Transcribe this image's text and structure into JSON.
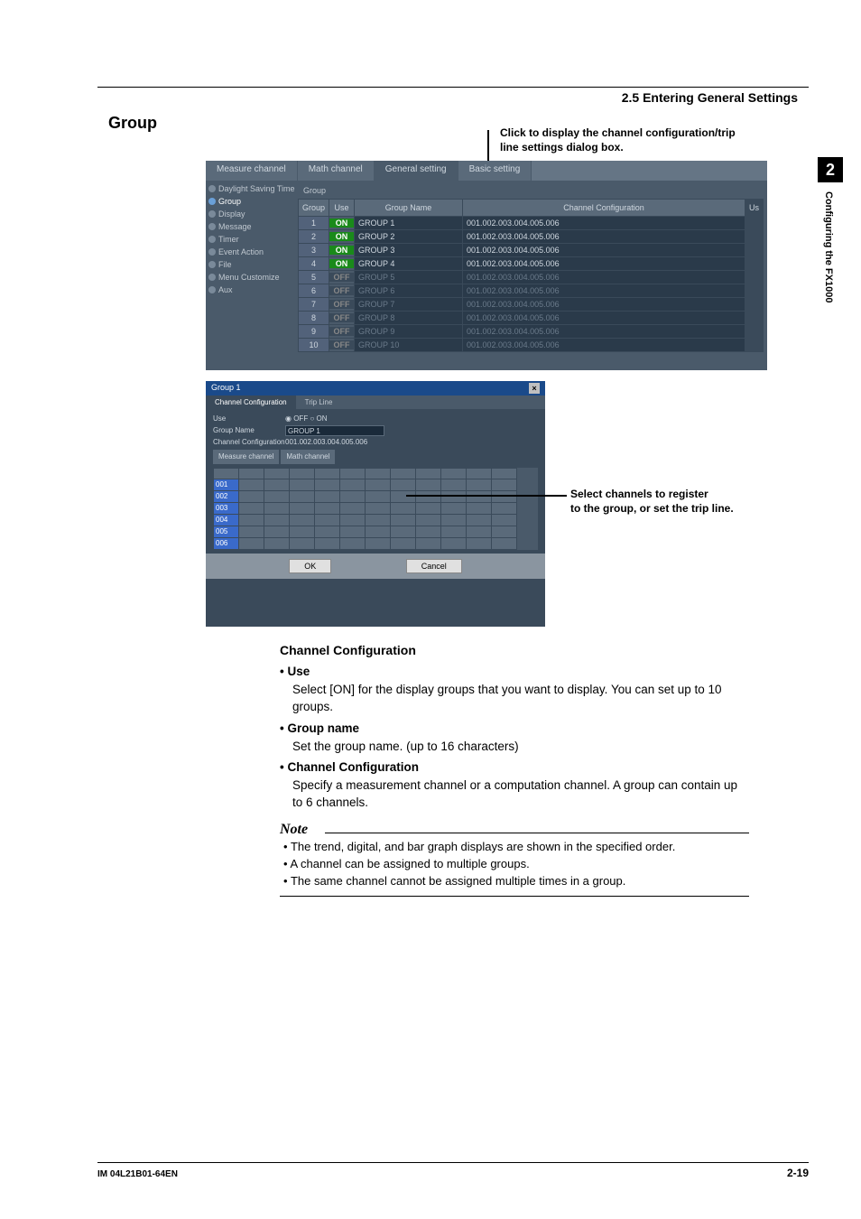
{
  "page": {
    "section_header": "2.5  Entering General Settings",
    "title": "Group",
    "footer_left": "IM 04L21B01-64EN",
    "footer_right": "2-19",
    "sidetab_num": "2",
    "sidetab_text": "Configuring the FX1000"
  },
  "anno": {
    "a1_l1": "Click to display the channel configuration/trip",
    "a1_l2": "line settings dialog box.",
    "a2_l1": "Select channels to register",
    "a2_l2": "to the group, or set the trip line."
  },
  "shot1": {
    "tabs": [
      "Measure channel",
      "Math channel",
      "General setting",
      "Basic setting"
    ],
    "sidebar": [
      "Daylight Saving Time",
      "Group",
      "Display",
      "Message",
      "Timer",
      "Event Action",
      "File",
      "Menu Customize",
      "Aux"
    ],
    "fieldset": "Group",
    "headers": {
      "group": "Group",
      "use": "Use",
      "gname": "Group Name",
      "cconf": "Channel Configuration",
      "us": "Us"
    },
    "rows": [
      {
        "n": "1",
        "use": "ON",
        "name": "GROUP 1",
        "conf": "001.002.003.004.005.006",
        "en": true
      },
      {
        "n": "2",
        "use": "ON",
        "name": "GROUP 2",
        "conf": "001.002.003.004.005.006",
        "en": true
      },
      {
        "n": "3",
        "use": "ON",
        "name": "GROUP 3",
        "conf": "001.002.003.004.005.006",
        "en": true
      },
      {
        "n": "4",
        "use": "ON",
        "name": "GROUP 4",
        "conf": "001.002.003.004.005.006",
        "en": true
      },
      {
        "n": "5",
        "use": "OFF",
        "name": "GROUP 5",
        "conf": "001.002.003.004.005.006",
        "en": false
      },
      {
        "n": "6",
        "use": "OFF",
        "name": "GROUP 6",
        "conf": "001.002.003.004.005.006",
        "en": false
      },
      {
        "n": "7",
        "use": "OFF",
        "name": "GROUP 7",
        "conf": "001.002.003.004.005.006",
        "en": false
      },
      {
        "n": "8",
        "use": "OFF",
        "name": "GROUP 8",
        "conf": "001.002.003.004.005.006",
        "en": false
      },
      {
        "n": "9",
        "use": "OFF",
        "name": "GROUP 9",
        "conf": "001.002.003.004.005.006",
        "en": false
      },
      {
        "n": "10",
        "use": "OFF",
        "name": "GROUP 10",
        "conf": "001.002.003.004.005.006",
        "en": false
      }
    ]
  },
  "shot2": {
    "title": "Group 1",
    "tabs": [
      "Channel Configuration",
      "Trip Line"
    ],
    "use_label": "Use",
    "use_off": "OFF",
    "use_on": "ON",
    "gname_label": "Group Name",
    "gname_value": "GROUP 1",
    "cconf_label": "Channel Configuration",
    "cconf_value": "001.002.003.004.005.006",
    "btn_measure": "Measure channel",
    "btn_math": "Math channel",
    "channels": [
      "001",
      "002",
      "003",
      "004",
      "005",
      "006"
    ],
    "ok": "OK",
    "cancel": "Cancel"
  },
  "content": {
    "cc_title": "Channel Configuration",
    "use_t": "•  Use",
    "use_b": "Select [ON] for the display groups that you want to display. You can set up to 10 groups.",
    "gn_t": "•  Group name",
    "gn_b": "Set the group name. (up to 16 characters)",
    "cc_t": "•  Channel Configuration",
    "cc_b": "Specify a measurement channel or a computation channel. A group can contain up to 6 channels.",
    "note": "Note",
    "n1": "The trend, digital, and bar graph displays are shown in the specified order.",
    "n2": "A channel can be assigned to multiple groups.",
    "n3": "The same channel cannot be assigned multiple times in a group."
  }
}
